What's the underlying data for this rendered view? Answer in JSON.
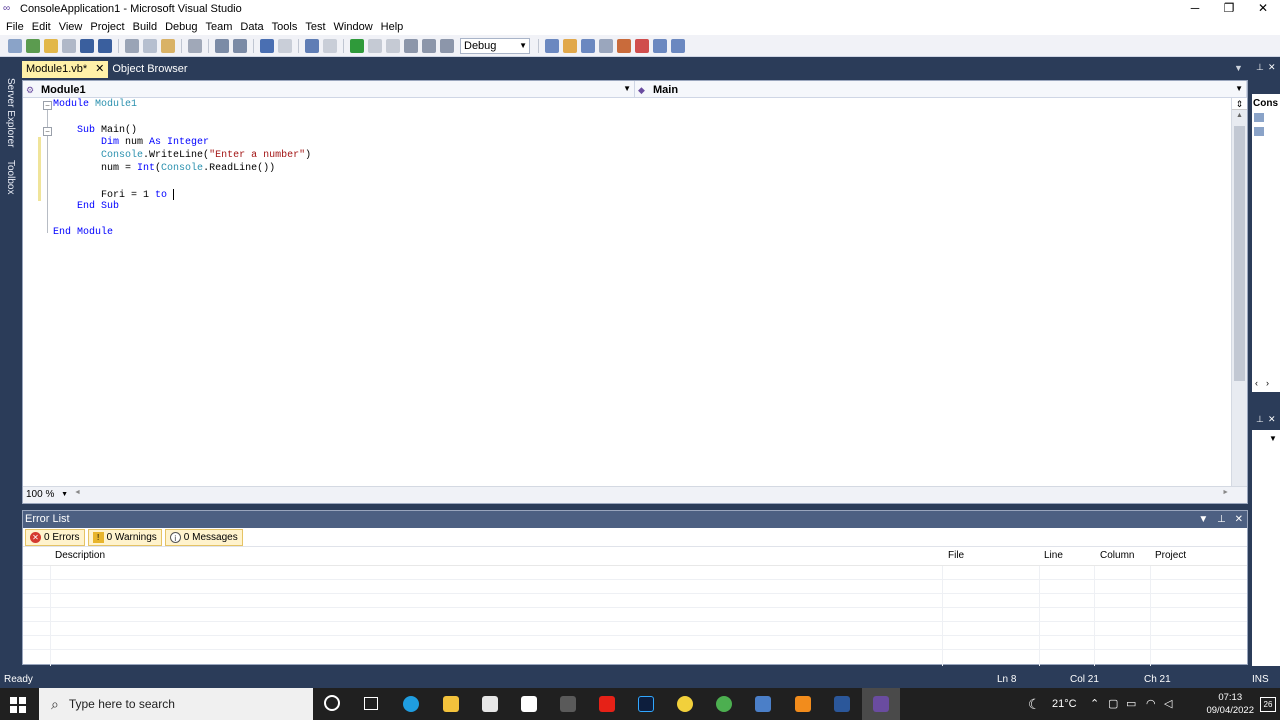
{
  "window": {
    "title": "ConsoleApplication1 - Microsoft Visual Studio",
    "minimize": "─",
    "restore": "❐",
    "close": "✕"
  },
  "menu": [
    "File",
    "Edit",
    "View",
    "Project",
    "Build",
    "Debug",
    "Team",
    "Data",
    "Tools",
    "Test",
    "Window",
    "Help"
  ],
  "toolbar": {
    "config_value": "Debug"
  },
  "side_tabs": {
    "server_explorer": "Server Explorer",
    "toolbox": "Toolbox"
  },
  "doc_tabs": [
    {
      "label": "Module1.vb*",
      "active": true,
      "close": "✕"
    },
    {
      "label": "Object Browser",
      "active": false
    }
  ],
  "nav": {
    "left": "Module1",
    "right": "Main"
  },
  "code_lines": [
    [
      {
        "t": "kw",
        "v": "Module "
      },
      {
        "t": "id",
        "v": "Module1"
      }
    ],
    [],
    [
      {
        "t": "plain",
        "v": "    "
      },
      {
        "t": "kw",
        "v": "Sub "
      },
      {
        "t": "plain",
        "v": "Main()"
      }
    ],
    [
      {
        "t": "plain",
        "v": "        "
      },
      {
        "t": "kw",
        "v": "Dim "
      },
      {
        "t": "plain",
        "v": "num "
      },
      {
        "t": "kw",
        "v": "As Integer"
      }
    ],
    [
      {
        "t": "plain",
        "v": "        "
      },
      {
        "t": "id",
        "v": "Console"
      },
      {
        "t": "plain",
        "v": "."
      },
      {
        "t": "plain",
        "v": "WriteLine("
      },
      {
        "t": "str",
        "v": "\"Enter a number\""
      },
      {
        "t": "plain",
        "v": ")"
      }
    ],
    [
      {
        "t": "plain",
        "v": "        num = "
      },
      {
        "t": "kw",
        "v": "Int"
      },
      {
        "t": "plain",
        "v": "("
      },
      {
        "t": "id",
        "v": "Console"
      },
      {
        "t": "plain",
        "v": ".ReadLine())"
      }
    ],
    [],
    [
      {
        "t": "plain",
        "v": "        Fori = 1 "
      },
      {
        "t": "kw",
        "v": "to "
      }
    ],
    [
      {
        "t": "plain",
        "v": "    "
      },
      {
        "t": "kw",
        "v": "End Sub"
      }
    ],
    [],
    [
      {
        "t": "kw",
        "v": "End Module"
      }
    ]
  ],
  "editor_zoom": "100 %",
  "error_list": {
    "title": "Error List",
    "errors": "0 Errors",
    "warnings": "0 Warnings",
    "messages": "0 Messages",
    "columns": [
      "Description",
      "File",
      "Line",
      "Column",
      "Project"
    ]
  },
  "right_panel": {
    "label": "Cons"
  },
  "status": {
    "ready": "Ready",
    "ln": "Ln 8",
    "col": "Col 21",
    "ch": "Ch 21",
    "ins": "INS"
  },
  "taskbar": {
    "search_placeholder": "Type here to search",
    "weather": "21°C",
    "time": "07:13",
    "date": "09/04/2022",
    "notifications": "26"
  },
  "colors": {
    "vs_chrome": "#2b3c59",
    "active_tab": "#fff1a8",
    "keyword": "#0000ff",
    "type": "#2b91af",
    "string": "#a31515"
  }
}
